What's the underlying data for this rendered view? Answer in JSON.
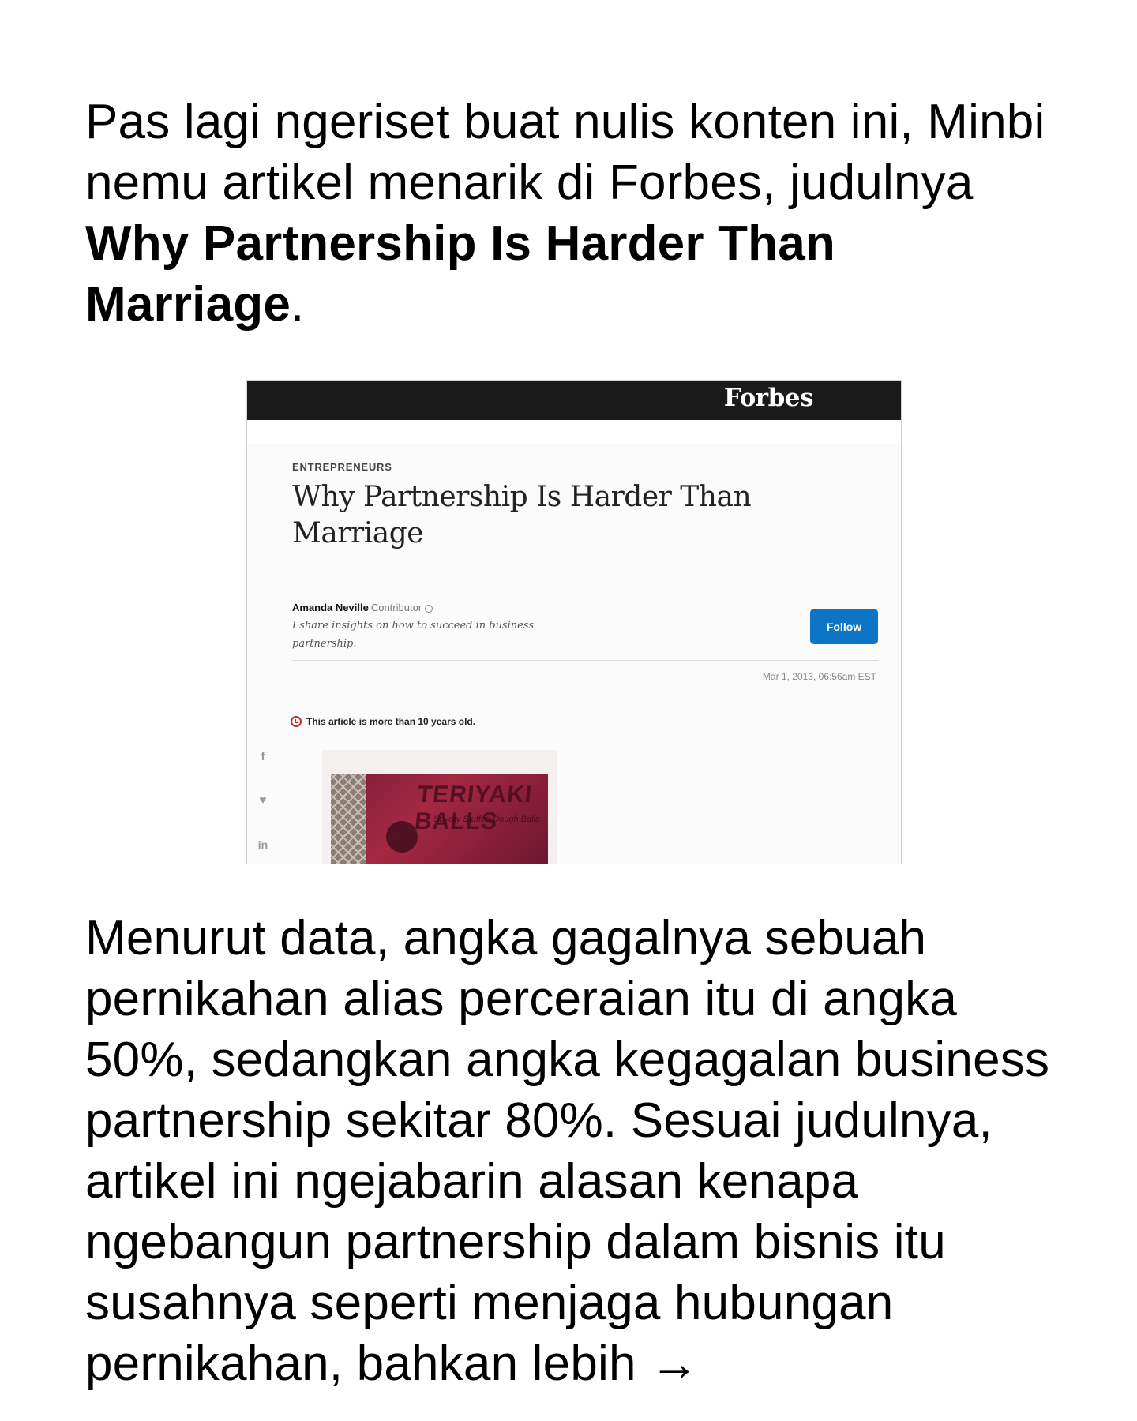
{
  "intro": {
    "text_before": "Pas lagi ngeriset buat nulis konten ini, Minbi nemu artikel menarik di Forbes, judulnya ",
    "bold_title": "Why Partnership Is Harder Than Marriage",
    "text_after": "."
  },
  "screenshot": {
    "brand": "Forbes",
    "category": "ENTREPRENEURS",
    "headline": "Why Partnership Is Harder Than Marriage",
    "author_name": "Amanda Neville",
    "author_role": "Contributor",
    "author_bio": "I share insights on how to succeed in business partnership.",
    "follow_label": "Follow",
    "date": "Mar 1, 2013, 06:56am EST",
    "notice": "This article is more than 10 years old.",
    "social_icons": [
      "facebook-icon",
      "twitter-icon",
      "linkedin-icon"
    ],
    "social_glyphs": {
      "facebook": "f",
      "twitter": "♥",
      "linkedin": "in"
    },
    "photo_sign": "TERIYAKI BALLS",
    "photo_subtext": "Savory Stuffed Dough Balls",
    "colors": {
      "topbar": "#1a1a1a",
      "follow_button": "#0c75c6",
      "notice_icon": "#c62828"
    }
  },
  "body": {
    "text": "Menurut data, angka gagalnya sebuah pernikahan alias perceraian itu di angka 50%, sedangkan angka kegagalan business partnership sekitar 80%. Sesuai judulnya, artikel ini ngejabarin alasan kenapa ngebangun partnership dalam bisnis itu susahnya seperti menjaga hubungan pernikahan, bahkan lebih →"
  }
}
